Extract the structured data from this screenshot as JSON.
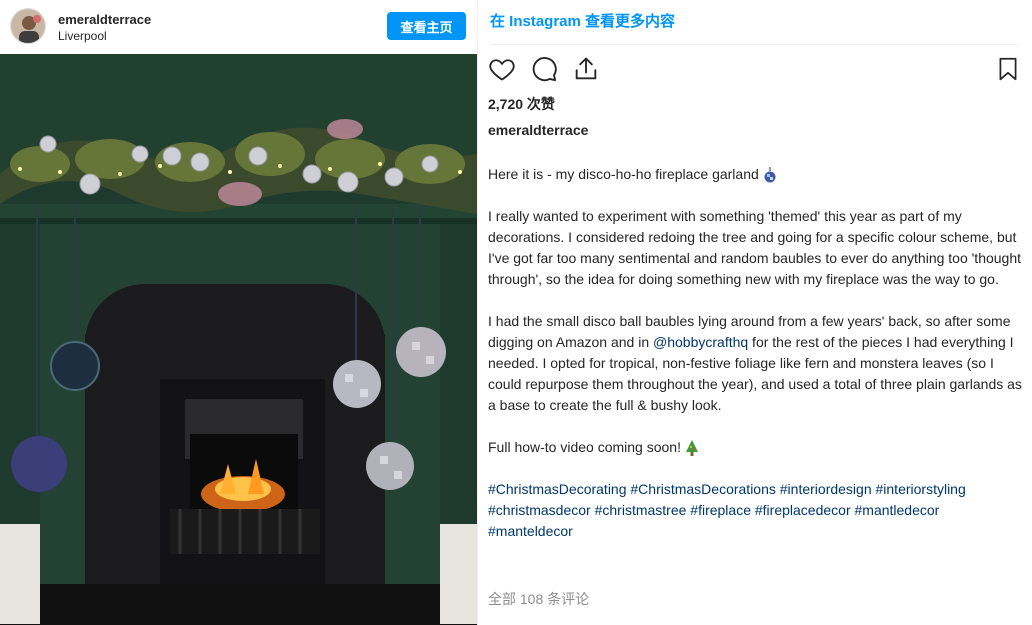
{
  "post": {
    "username": "emeraldterrace",
    "location": "Liverpool",
    "view_button": "查看主页"
  },
  "right_panel": {
    "top_link": "在 Instagram 查看更多内容",
    "likes": "2,720 次赞",
    "caption_username": "emeraldterrace",
    "caption": {
      "p1": "Here it is - my disco-ho-ho fireplace garland",
      "p2": "I really wanted to experiment with something 'themed' this year as part of my decorations. I considered redoing the tree and going for a specific colour scheme, but I've got far too many sentimental and random baubles to ever do anything too 'thought through', so the idea for doing something new with my fireplace was the way to go.",
      "p3_before": "I had the small disco ball baubles lying around from a few years' back, so after some digging on Amazon and in ",
      "p3_mention": "@hobbycrafthq",
      "p3_after": " for the rest of the pieces I had everything I needed. I opted for tropical, non-festive foliage like fern and monstera leaves (so I could repurpose them throughout the year), and used a total of three plain garlands as a base to create the full & bushy look.",
      "p4": "Full how-to video coming soon!",
      "hashtags": "#ChristmasDecorating #ChristmasDecorations #interiordesign #interiorstyling #christmasdecor #christmastree #fireplace #fireplacedecor #mantledecor #manteldecor"
    },
    "comments_link": "全部 108 条评论"
  },
  "icons": [
    "heart-icon",
    "comment-icon",
    "share-icon",
    "bookmark-icon",
    "disco-ball-emoji",
    "tree-emoji"
  ],
  "colors": {
    "accent": "#0095f6",
    "wall": "#1f3a2e",
    "text": "#262626",
    "muted": "#8e8e8e",
    "link": "#00376b"
  }
}
